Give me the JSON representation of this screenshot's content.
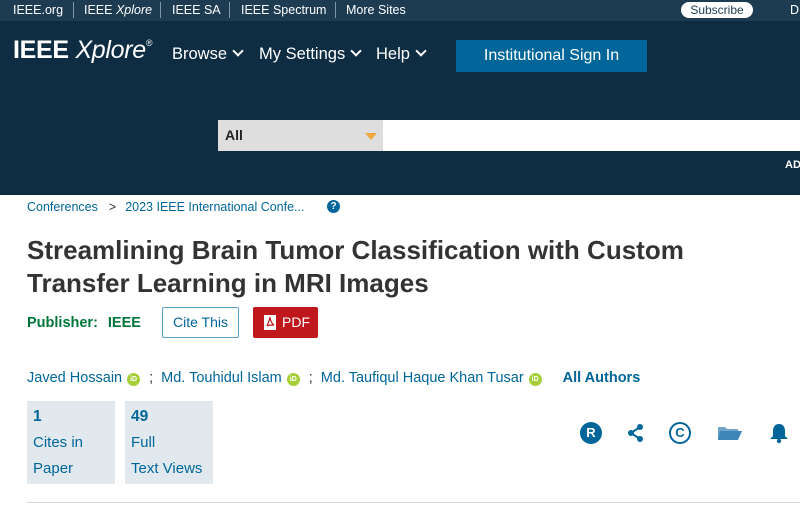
{
  "meta_bar": {
    "links": [
      "IEEE.org",
      "IEEE Xplore",
      "IEEE SA",
      "IEEE Spectrum",
      "More Sites"
    ],
    "subscribe_label": "Subscribe",
    "cut_text": "D"
  },
  "header": {
    "logo_bold": "IEEE",
    "logo_italic": "Xplore",
    "logo_mark": "®",
    "nav": [
      "Browse",
      "My Settings",
      "Help"
    ],
    "signin_label": "Institutional Sign In",
    "search": {
      "scope": "All",
      "value": "",
      "placeholder": ""
    },
    "advanced_cut": "AD"
  },
  "breadcrumb": {
    "items": [
      "Conferences",
      "2023 IEEE International Confe..."
    ],
    "separator": ">",
    "help_glyph": "?"
  },
  "article": {
    "title": "Streamlining Brain Tumor Classification with Custom Transfer Learning in MRI Images",
    "publisher_label": "Publisher:",
    "publisher_name": "IEEE",
    "cite_label": "Cite This",
    "pdf_label": "PDF",
    "authors": [
      "Javed Hossain",
      "Md. Touhidul Islam",
      "Md. Taufiqul Haque Khan Tusar"
    ],
    "author_separator": ";",
    "all_authors_label": "All Authors",
    "orcid_glyph": "iD"
  },
  "metrics": [
    {
      "number": "1",
      "label": "Cites in\nPaper"
    },
    {
      "number": "49",
      "label": "Full\nText Views"
    }
  ],
  "actions": [
    {
      "icon": "rights-icon",
      "glyph": "R"
    },
    {
      "icon": "share-icon"
    },
    {
      "icon": "copyright-icon",
      "glyph": "C"
    },
    {
      "icon": "folder-icon"
    },
    {
      "icon": "bell-icon"
    }
  ],
  "colors": {
    "header_bg": "#0e2c42",
    "meta_bg": "#1d3c52",
    "link_blue": "#006699",
    "publisher_green": "#00773a",
    "pdf_red": "#c0171c",
    "orcid_green": "#a6ce39",
    "metric_bg": "#e1e9ef",
    "search_caret": "#f0a83c"
  }
}
